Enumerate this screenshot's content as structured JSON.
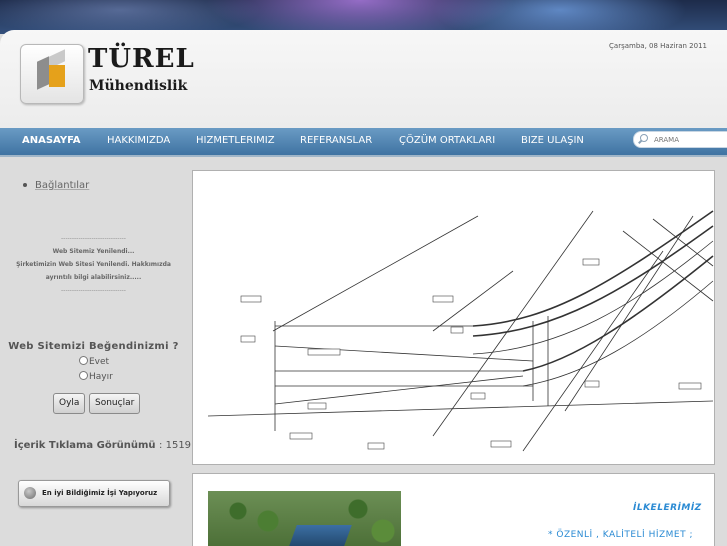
{
  "brand": {
    "name": "TÜREL",
    "subtitle": "Mühendislik"
  },
  "date": "Çarşamba, 08 Haziran 2011",
  "nav": {
    "items": [
      "ANASAYFA",
      "HAKKIMIZDA",
      "HIZMETLERIMIZ",
      "REFERANSLAR",
      "ÇÖZÜM ORTAKLARI",
      "BIZE ULAŞIN"
    ],
    "active": "ANASAYFA"
  },
  "search": {
    "placeholder": "ARAMA"
  },
  "sidebar": {
    "links_label": "Bağlantılar",
    "news": {
      "separator": "------------------------------",
      "title": "Web Sitemiz Yenilendi...",
      "line1": "Şirketimizin Web Sitesi Yenilendi. Hakkımızda",
      "line2": "ayrıntılı bilgi alabilirsiniz.....",
      "separator2": "------------------------------"
    },
    "poll": {
      "question": "Web Sitemizi Beğendinizmi ?",
      "options": [
        "Evet",
        "Hayır"
      ],
      "vote_button": "Oyla",
      "results_button": "Sonuçlar"
    },
    "clicks_label": "İçerik Tıklama Görünümü",
    "clicks_value": ": 1519",
    "slogan": "En iyi Bildiğimiz İşi Yapıyoruz"
  },
  "main": {
    "principles_title": "İLKELERİMİZ",
    "principles_first": "* ÖZENLİ , KALİTELİ HİZMET ;"
  },
  "colors": {
    "nav_top": "#6a9bc4",
    "nav_bottom": "#3f73a2",
    "accent_text": "#2a8ad3",
    "logo_orange": "#e5a11b"
  }
}
